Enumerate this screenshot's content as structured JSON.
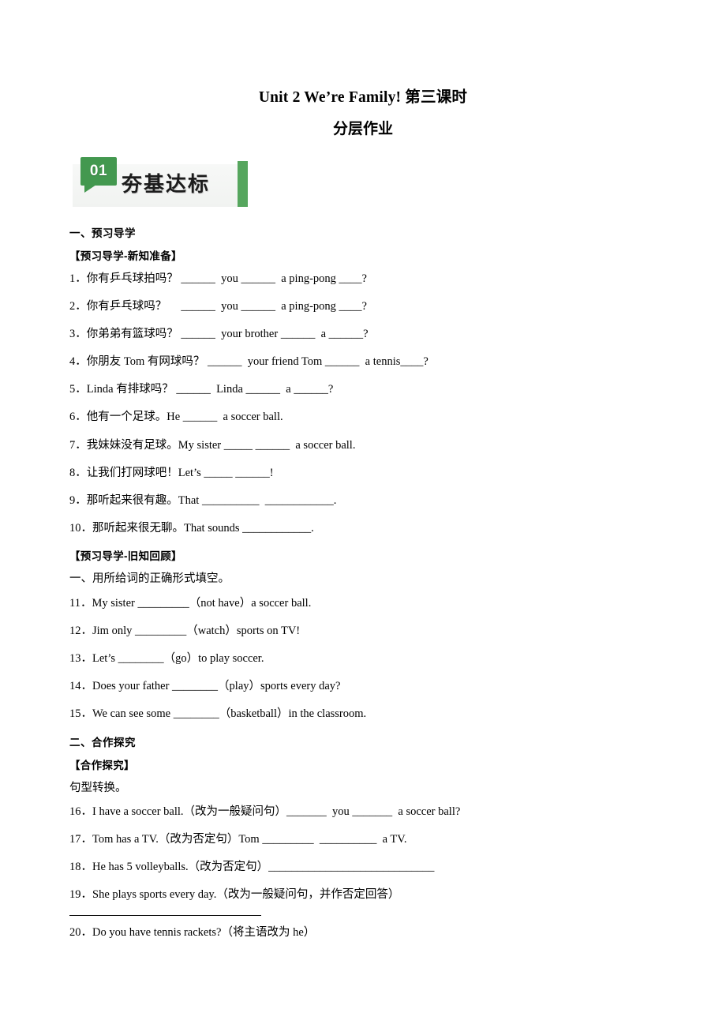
{
  "document": {
    "title": "Unit 2 We’re Family!  第三课时",
    "subtitle": "分层作业"
  },
  "banner": {
    "number": "01",
    "label": "夯基达标",
    "accent_color": "#43984f",
    "bar_color": "#56a65e",
    "background_color": "#f3f4f3"
  },
  "sections": [
    {
      "heading": "一、预习导学",
      "subheading": "【预习导学-新知准备】",
      "items": [
        "1．你有乒乓球拍吗？ ______  you ______  a ping-pong ____?",
        "2．你有乒乓球吗？　 ______  you ______  a ping-pong ____?",
        "3．你弟弟有篮球吗？ ______  your brother ______  a ______?",
        "4．你朋友 Tom 有网球吗？ ______  your friend Tom ______  a tennis____?",
        "5．Linda 有排球吗？ ______  Linda ______  a ______?",
        "6．他有一个足球。He ______  a soccer ball.",
        "7．我妹妹没有足球。My sister _____ ______  a soccer ball.",
        "8．让我们打网球吧！Let’s _____ ______!",
        "9．那听起来很有趣。That __________  ____________.",
        "10．那听起来很无聊。That sounds ____________."
      ]
    },
    {
      "subheading": "【预习导学-旧知回顾】",
      "instruction": "一、用所给词的正确形式填空。",
      "items": [
        "11．My sister _________（not have）a soccer ball.",
        "12．Jim only _________（watch）sports on TV!",
        "13．Let’s ________（go）to play soccer.",
        "14．Does your father ________（play）sports every day?",
        "15．We can see some ________（basketball）in the classroom."
      ]
    },
    {
      "heading": "二、合作探究",
      "subheading": "【合作探究】",
      "instruction": "句型转换。",
      "items": [
        "16．I have a soccer ball.（改为一般疑问句）_______  you _______  a soccer ball?",
        "17．Tom has a TV.（改为否定句）Tom _________  __________  a TV.",
        "18．He has 5 volleyballs.（改为否定句）_____________________________",
        "19．She plays sports every day.（改为一般疑问句，并作否定回答）",
        "20．Do you have tennis rackets?（将主语改为 he）"
      ],
      "answer_rule_after_item": 4
    }
  ]
}
